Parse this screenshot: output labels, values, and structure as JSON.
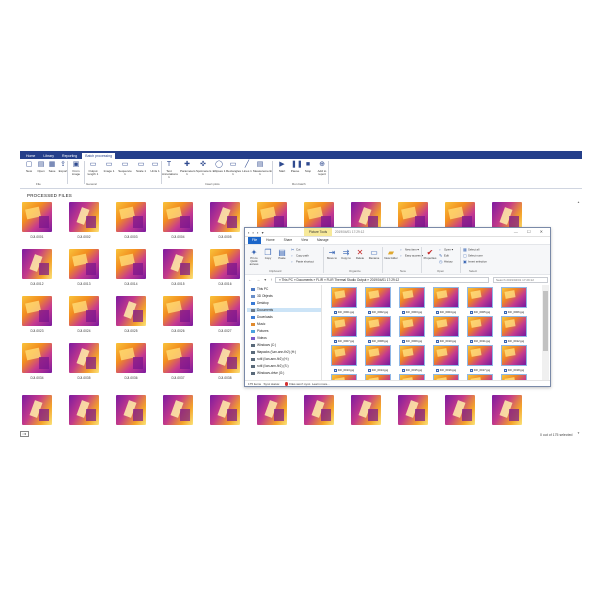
{
  "app": {
    "tabs": [
      "Home",
      "Library",
      "Reporting",
      "Batch processing"
    ],
    "active_tab": 3,
    "ribbon_buttons": [
      {
        "label": "New",
        "icon": "new-icon"
      },
      {
        "label": "Open",
        "icon": "open-icon"
      },
      {
        "label": "Save",
        "icon": "save-icon"
      },
      {
        "label": "Export",
        "icon": "export-icon"
      },
      {
        "label": "From image",
        "icon": "from-image-icon"
      },
      {
        "label": "Output length 1",
        "icon": "output-length-icon"
      },
      {
        "label": "Image 1",
        "icon": "image-icon"
      },
      {
        "label": "Sequence 1",
        "icon": "sequence-icon"
      },
      {
        "label": "Scale 1",
        "icon": "scale-icon"
      },
      {
        "label": "Units 1",
        "icon": "units-icon"
      },
      {
        "label": "Text Annotations 1",
        "icon": "text-annotations-icon"
      },
      {
        "label": "Parameters 1",
        "icon": "parameters-icon"
      },
      {
        "label": "Spotmeters 1",
        "icon": "spotmeters-icon"
      },
      {
        "label": "Ellipses 1",
        "icon": "ellipses-icon"
      },
      {
        "label": "Rectangles 1",
        "icon": "rectangles-icon"
      },
      {
        "label": "Lines 1",
        "icon": "lines-icon"
      },
      {
        "label": "Measurements 1",
        "icon": "measurements-icon"
      },
      {
        "label": "Start",
        "icon": "start-icon"
      },
      {
        "label": "Pause",
        "icon": "pause-icon"
      },
      {
        "label": "Stop",
        "icon": "stop-icon"
      },
      {
        "label": "Add to report",
        "icon": "add-to-report-icon"
      }
    ],
    "groups": [
      "File",
      "General",
      "Insert plots",
      "Run batch"
    ],
    "heading": "PROCESSED FILES",
    "captions": [
      "DJI-0001",
      "DJI-0002",
      "DJI-0003",
      "DJI-0004",
      "DJI-0005",
      "DJI-0006",
      "DJI-0007",
      "DJI-0008",
      "DJI-0009",
      "DJI-0010",
      "DJI-0011",
      "DJI-0012",
      "DJI-0013",
      "DJI-0014",
      "DJI-0015",
      "DJI-0016",
      "DJI-0017",
      "DJI-0018",
      "DJI-0019",
      "DJI-0020",
      "DJI-0021",
      "DJI-0022",
      "DJI-0023",
      "DJI-0024",
      "DJI-0025",
      "DJI-0026",
      "DJI-0027",
      "DJI-0028",
      "DJI-0029",
      "DJI-0030",
      "DJI-0031",
      "DJI-0032",
      "DJI-0033",
      "DJI-0034",
      "DJI-0035",
      "DJI-0036",
      "DJI-0037",
      "DJI-0038",
      "DJI-0039",
      "DJI-0040",
      "DJI-0041",
      "DJI-0042",
      "DJI-0043",
      "DJI-0044"
    ],
    "selection_status": "0 out of 175 selected",
    "zoom_label": "□▾"
  },
  "explorer": {
    "title_path": "2019/04/01 17:29:12",
    "context_tab": "Picture Tools",
    "qat": "▪ ▪ ▪ ▾",
    "window_buttons": "— ☐ ✕",
    "tabs": [
      "File",
      "Home",
      "Share",
      "View",
      "Manage"
    ],
    "ribbon": {
      "pin": "Pin to Quick access",
      "copy": "Copy",
      "paste": "Paste",
      "cut": "Cut",
      "copy_path": "Copy path",
      "paste_shortcut": "Paste shortcut",
      "move_to": "Move to",
      "copy_to": "Copy to",
      "delete": "Delete",
      "rename": "Rename",
      "new_folder": "New folder",
      "new_item": "New item ▾",
      "easy_access": "Easy access ▾",
      "properties": "Properties",
      "open": "Open ▾",
      "edit": "Edit",
      "history": "History",
      "select_all": "Select all",
      "select_none": "Select none",
      "invert_selection": "Invert selection",
      "group_clipboard": "Clipboard",
      "group_organize": "Organize",
      "group_new": "New",
      "group_open": "Open",
      "group_select": "Select"
    },
    "nav_arrows": "← → ▾ ↑",
    "address": "» This PC  »  Documents  »  FLIR  »  FLIR Thermal Studio Output  »  2019/04/01 17:29:12",
    "search_placeholder": "Search 2019/04/01 17:29:12",
    "nav_items": [
      "This PC",
      "3D Objects",
      "Desktop",
      "Documents",
      "Downloads",
      "Music",
      "Pictures",
      "Videos",
      "Windows (C:)",
      "fitapacks (\\\\an-ann-flr2) (H:)",
      "ruttl (\\\\an-ann-flr2) (H:)",
      "ruttl (\\\\an-ann-flr2) (S:)",
      "Windows-drive (G:)"
    ],
    "selected_nav": 3,
    "files": [
      "DJI_0001.jpg",
      "DJI_0002.jpg",
      "DJI_0003.jpg",
      "DJI_0004.jpg",
      "DJI_0005.jpg",
      "DJI_0006.jpg",
      "DJI_0007.jpg",
      "DJI_0008.jpg",
      "DJI_0009.jpg",
      "DJI_0010.jpg",
      "DJI_0011.jpg",
      "DJI_0012.jpg",
      "DJI_0013.jpg",
      "DJI_0014.jpg",
      "DJI_0015.jpg",
      "DJI_0016.jpg",
      "DJI_0017.jpg",
      "DJI_0018.jpg",
      "DJI_0019.jpg",
      "DJI_0020.jpg",
      "DJI_0021.jpg",
      "DJI_0022.jpg",
      "DJI_0023.jpg",
      "DJI_0024.jpg"
    ],
    "status_count": "175 items",
    "status_sync": "Sync status:",
    "status_msg": "Files won't sync. Learn more..."
  },
  "colors": {
    "accent": "#253f8a",
    "file_tab": "#1c66c9",
    "selection": "#cce4f7"
  }
}
